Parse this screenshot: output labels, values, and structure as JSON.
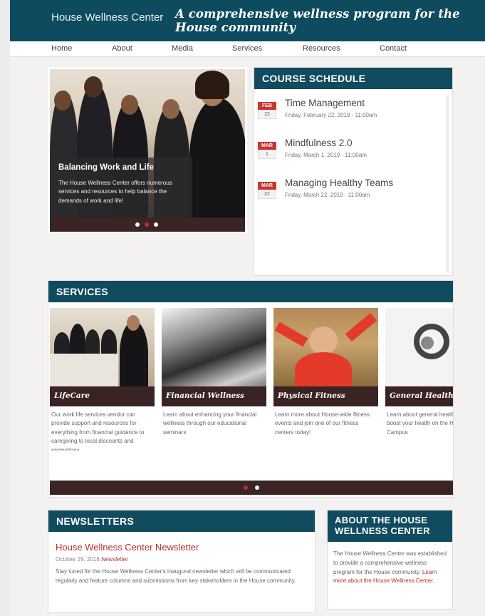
{
  "header": {
    "site_name": "House Wellness Center",
    "tagline": "A comprehensive wellness program for the House community",
    "brand_color": "#0f4b5e"
  },
  "nav": {
    "items": [
      "Home",
      "About",
      "Media",
      "Services",
      "Resources",
      "Contact"
    ]
  },
  "hero": {
    "title": "Balancing Work and Life",
    "text": "The House Wellness Center offers numerous services and resources to help balance the demands of work and life!",
    "slides": 3,
    "active_slide": 2
  },
  "schedule": {
    "heading": "COURSE SCHEDULE",
    "courses": [
      {
        "month": "FEB",
        "day": "22",
        "title": "Time Management",
        "date": "Friday, February 22, 2019 - 11:00am"
      },
      {
        "month": "MAR",
        "day": "1",
        "title": "Mindfulness 2.0",
        "date": "Friday, March 1, 2019 - 11:00am"
      },
      {
        "month": "MAR",
        "day": "22",
        "title": "Managing Healthy Teams",
        "date": "Friday, March 22, 2019 - 11:00am"
      }
    ]
  },
  "services": {
    "heading": "SERVICES",
    "items": [
      {
        "title": "LifeCare",
        "text": "Our work life services vendor can provide support and resources for everything from financial guidance to caregiving to local discounts and promotions"
      },
      {
        "title": "Financial Wellness",
        "text": "Learn about enhancing your financial wellness through our educational seminars"
      },
      {
        "title": "Physical Fitness",
        "text": "Learn more about House-wide fitness events and join one of our fitness centers today!"
      },
      {
        "title": "General Health",
        "text": "Learn about general health services to boost your health on the House Campus"
      }
    ],
    "pages": 2,
    "active_page": 1
  },
  "newsletters": {
    "heading": "NEWSLETTERS",
    "title": "House Wellness Center Newsletter",
    "date": "October 29, 2018",
    "tag": "Newsletter",
    "text": "Stay tuned for the House Wellness Center's inaugural newsletter which will be communicated regularly and feature columns and submissions from key stakeholders in the House community."
  },
  "about": {
    "heading": "ABOUT THE HOUSE WELLNESS CENTER",
    "text": "The House Wellness Center was established to provide a comprehensive wellness program for the House community.",
    "link": "Learn more about the House Wellness Center."
  }
}
